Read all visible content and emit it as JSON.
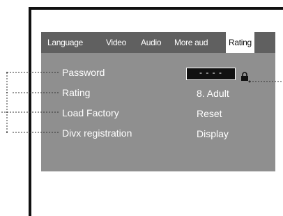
{
  "tabs": [
    {
      "label": "Language"
    },
    {
      "label": "Video"
    },
    {
      "label": "Audio"
    },
    {
      "label": "More aud"
    },
    {
      "label": "Rating",
      "selected": true
    }
  ],
  "menu": {
    "password": {
      "label": "Password",
      "value": "- - - -"
    },
    "rating": {
      "label": "Rating",
      "value": "8. Adult"
    },
    "load_factory": {
      "label": "Load Factory",
      "value": "Reset"
    },
    "divx_registration": {
      "label": "Divx registration",
      "value": "Display"
    }
  },
  "icons": {
    "lock": "lock-icon"
  },
  "colors": {
    "panel_background": "#8f8f8f",
    "tab_bar_background": "#606060",
    "selected_tab_background": "#ffffff",
    "password_box_background": "#111111",
    "text": "#ffffff"
  }
}
